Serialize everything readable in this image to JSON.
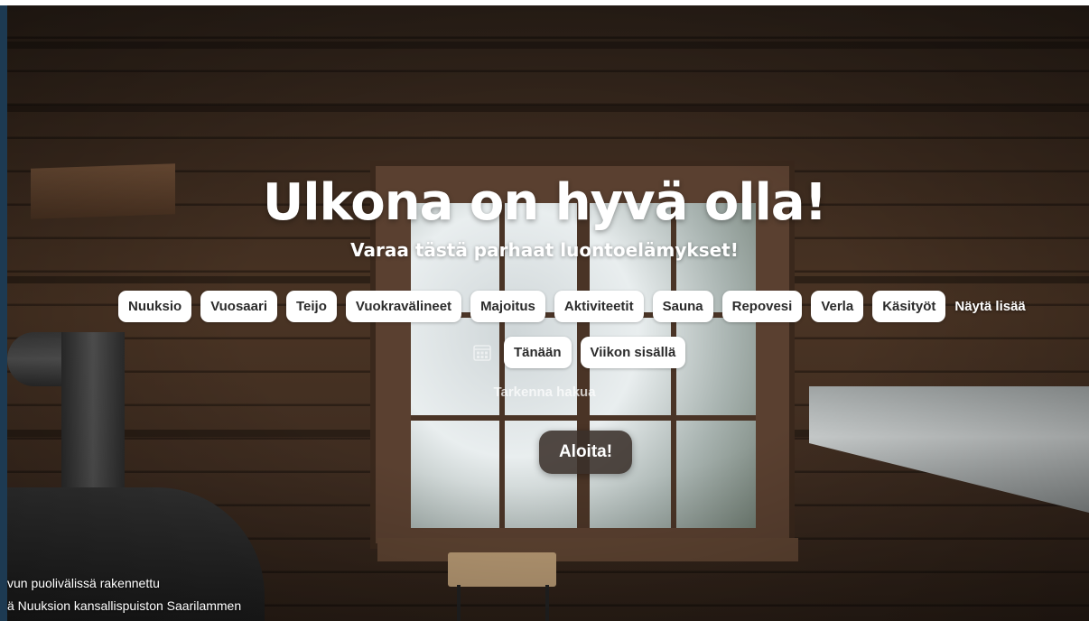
{
  "hero": {
    "title": "Ulkona on hyvä olla!",
    "subtitle": "Varaa tästä parhaat luontoelämykset!"
  },
  "categories": [
    "Nuuksio",
    "Vuosaari",
    "Teijo",
    "Vuokravälineet",
    "Majoitus",
    "Aktiviteetit",
    "Sauna",
    "Repovesi",
    "Verla",
    "Käsityöt"
  ],
  "show_more_label": "Näytä lisää",
  "date_filter": {
    "icon": "calendar-icon",
    "options": [
      "Tänään",
      "Viikon sisällä"
    ]
  },
  "refine_label": "Tarkenna hakua",
  "start_button_label": "Aloita!",
  "image_caption": {
    "line1": "vun puolivälissä rakennettu",
    "line2": "ä Nuuksion kansallispuiston Saarilammen"
  },
  "colors": {
    "chip_bg": "#ffffff",
    "chip_text": "#2b2b2b",
    "start_button_bg": "#3a302a",
    "hero_text": "#ffffff"
  }
}
